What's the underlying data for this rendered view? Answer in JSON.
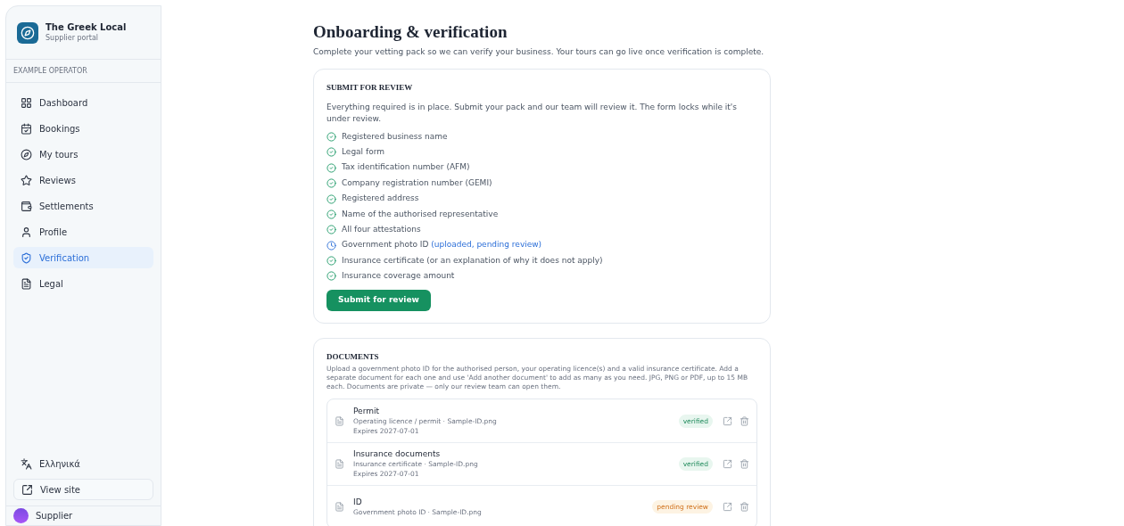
{
  "brand": {
    "name": "The Greek Local",
    "subtitle": "Supplier portal"
  },
  "sidebar": {
    "operator": "EXAMPLE OPERATOR",
    "items": [
      {
        "label": "Dashboard",
        "selected": false
      },
      {
        "label": "Bookings",
        "selected": false
      },
      {
        "label": "My tours",
        "selected": false
      },
      {
        "label": "Reviews",
        "selected": false
      },
      {
        "label": "Settlements",
        "selected": false
      },
      {
        "label": "Profile",
        "selected": false
      },
      {
        "label": "Verification",
        "selected": true
      },
      {
        "label": "Legal",
        "selected": false
      }
    ],
    "language": "Ελληνικά",
    "view_site": "View site",
    "user": "Supplier"
  },
  "page": {
    "title": "Onboarding & verification",
    "subtitle": "Complete your vetting pack so we can verify your business. Your tours can go live once verification is complete."
  },
  "submit_card": {
    "heading": "SUBMIT FOR REVIEW",
    "intro": "Everything required is in place. Submit your pack and our team will review it. The form locks while it's under review.",
    "checklist": [
      {
        "label": "Registered business name",
        "kind": "done"
      },
      {
        "label": "Legal form",
        "kind": "done"
      },
      {
        "label": "Tax identification number (AFM)",
        "kind": "done"
      },
      {
        "label": "Company registration number (GEMI)",
        "kind": "done"
      },
      {
        "label": "Registered address",
        "kind": "done"
      },
      {
        "label": "Name of the authorised representative",
        "kind": "done"
      },
      {
        "label": "All four attestations",
        "kind": "done"
      },
      {
        "label": "Government photo ID",
        "note": "(uploaded, pending review)",
        "kind": "pending"
      },
      {
        "label": "Insurance certificate (or an explanation of why it does not apply)",
        "kind": "done"
      },
      {
        "label": "Insurance coverage amount",
        "kind": "done"
      }
    ],
    "button": "Submit for review"
  },
  "documents": {
    "heading": "DOCUMENTS",
    "intro": "Upload a government photo ID for the authorised person, your operating licence(s) and a valid insurance certificate. Add a separate document for each one and use 'Add another document' to add as many as you need. JPG, PNG or PDF, up to 15 MB each. Documents are private — only our review team can open them.",
    "items": [
      {
        "title": "Permit",
        "detail": "Operating licence / permit · Sample-ID.png",
        "expires": "Expires 2027-07-01",
        "status": "verified",
        "kind": "verified"
      },
      {
        "title": "Insurance documents",
        "detail": "Insurance certificate · Sample-ID.png",
        "expires": "Expires 2027-07-01",
        "status": "verified",
        "kind": "verified"
      },
      {
        "title": "ID",
        "detail": "Government photo ID · Sample-ID.png",
        "status": "pending review",
        "kind": "pending"
      }
    ]
  }
}
